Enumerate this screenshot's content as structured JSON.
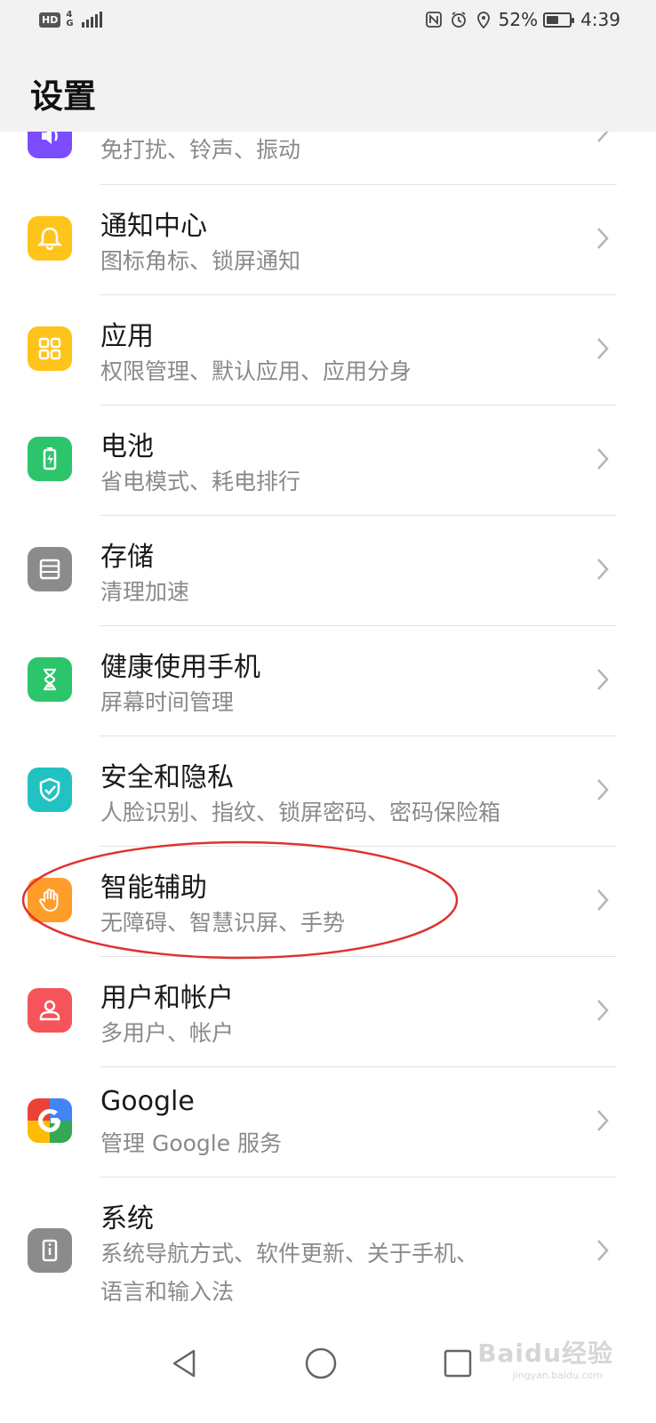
{
  "status_bar": {
    "hd": "HD",
    "network": "4G",
    "battery": "52%",
    "time": "4:39"
  },
  "header": {
    "title": "设置"
  },
  "settings": [
    {
      "icon": "sound-icon",
      "title": "",
      "subtitle": "免打扰、铃声、振动",
      "color": "#7b4dff"
    },
    {
      "icon": "bell-icon",
      "title": "通知中心",
      "subtitle": "图标角标、锁屏通知",
      "color": "#ffc41c"
    },
    {
      "icon": "apps-grid-icon",
      "title": "应用",
      "subtitle": "权限管理、默认应用、应用分身",
      "color": "#ffc41c"
    },
    {
      "icon": "battery-icon",
      "title": "电池",
      "subtitle": "省电模式、耗电排行",
      "color": "#2cc56b"
    },
    {
      "icon": "storage-icon",
      "title": "存储",
      "subtitle": "清理加速",
      "color": "#8b8b8b"
    },
    {
      "icon": "hourglass-icon",
      "title": "健康使用手机",
      "subtitle": "屏幕时间管理",
      "color": "#2cc56b"
    },
    {
      "icon": "shield-icon",
      "title": "安全和隐私",
      "subtitle": "人脸识别、指纹、锁屏密码、密码保险箱",
      "color": "#23c2c2"
    },
    {
      "icon": "hand-icon",
      "title": "智能辅助",
      "subtitle": "无障碍、智慧识屏、手势",
      "color": "#ff9d2b"
    },
    {
      "icon": "user-icon",
      "title": "用户和帐户",
      "subtitle": "多用户、帐户",
      "color": "#f4545a"
    },
    {
      "icon": "google-icon",
      "title": "Google",
      "subtitle": "管理 Google 服务",
      "color": "#ffffff"
    },
    {
      "icon": "info-icon",
      "title": "系统",
      "subtitle": "系统导航方式、软件更新、关于手机、",
      "subtitle2": "语言和输入法",
      "color": "#8b8b8b"
    }
  ],
  "watermark": {
    "text": "Baidu经验",
    "sub": "jingyan.baidu.com"
  },
  "nav": {
    "back": "back-icon",
    "home": "home-icon",
    "recents": "recents-icon"
  }
}
